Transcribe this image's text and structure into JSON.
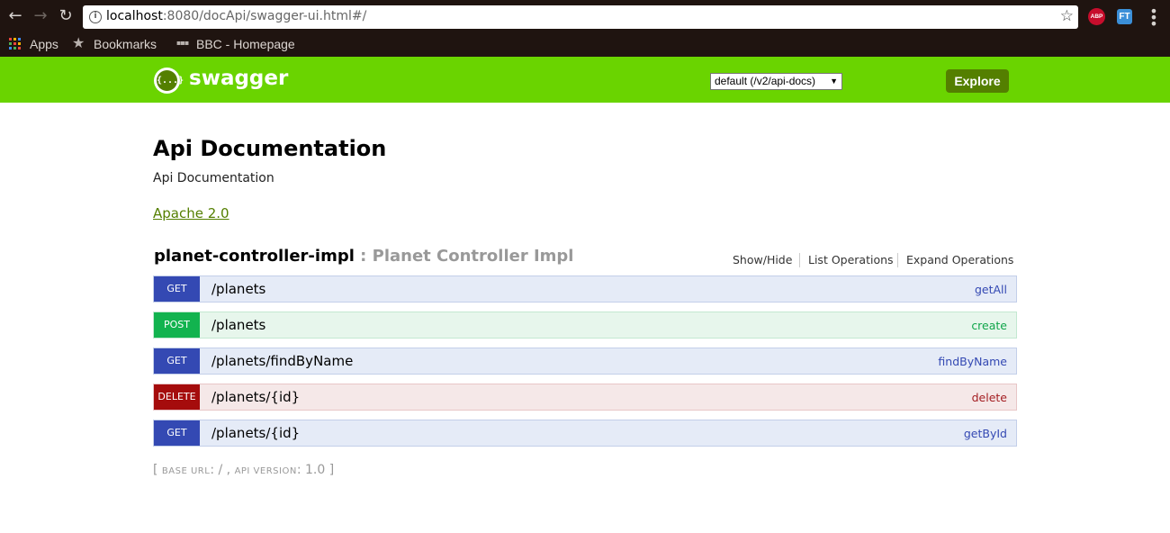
{
  "browser": {
    "url_host": "localhost",
    "url_rest": ":8080/docApi/swagger-ui.html#/",
    "extensions": [
      "ABP",
      "FT"
    ],
    "bookmarks": [
      "Apps",
      "Bookmarks",
      "BBC - Homepage"
    ]
  },
  "header": {
    "logo_text": "swagger",
    "logo_glyph": "{...}",
    "spec_selected": "default (/v2/api-docs)",
    "explore_label": "Explore"
  },
  "info": {
    "title": "Api Documentation",
    "description": "Api Documentation",
    "license": "Apache 2.0"
  },
  "resource": {
    "name": "planet-controller-impl",
    "separator": ":",
    "description": "Planet Controller Impl",
    "links": [
      "Show/Hide",
      "List Operations",
      "Expand Operations"
    ]
  },
  "operations": [
    {
      "method": "GET",
      "path": "/planets",
      "nickname": "getAll"
    },
    {
      "method": "POST",
      "path": "/planets",
      "nickname": "create"
    },
    {
      "method": "GET",
      "path": "/planets/findByName",
      "nickname": "findByName"
    },
    {
      "method": "DELETE",
      "path": "/planets/{id}",
      "nickname": "delete"
    },
    {
      "method": "GET",
      "path": "/planets/{id}",
      "nickname": "getById"
    }
  ],
  "footer": {
    "open": "[",
    "base_url_label": "base url",
    "base_url": "/",
    "api_version_label": "api version",
    "api_version": "1.0",
    "close": "]"
  },
  "colors": {
    "swagger_green": "#6ad400",
    "get": "#3449b3",
    "post": "#12b34f",
    "delete": "#a50c0c"
  }
}
